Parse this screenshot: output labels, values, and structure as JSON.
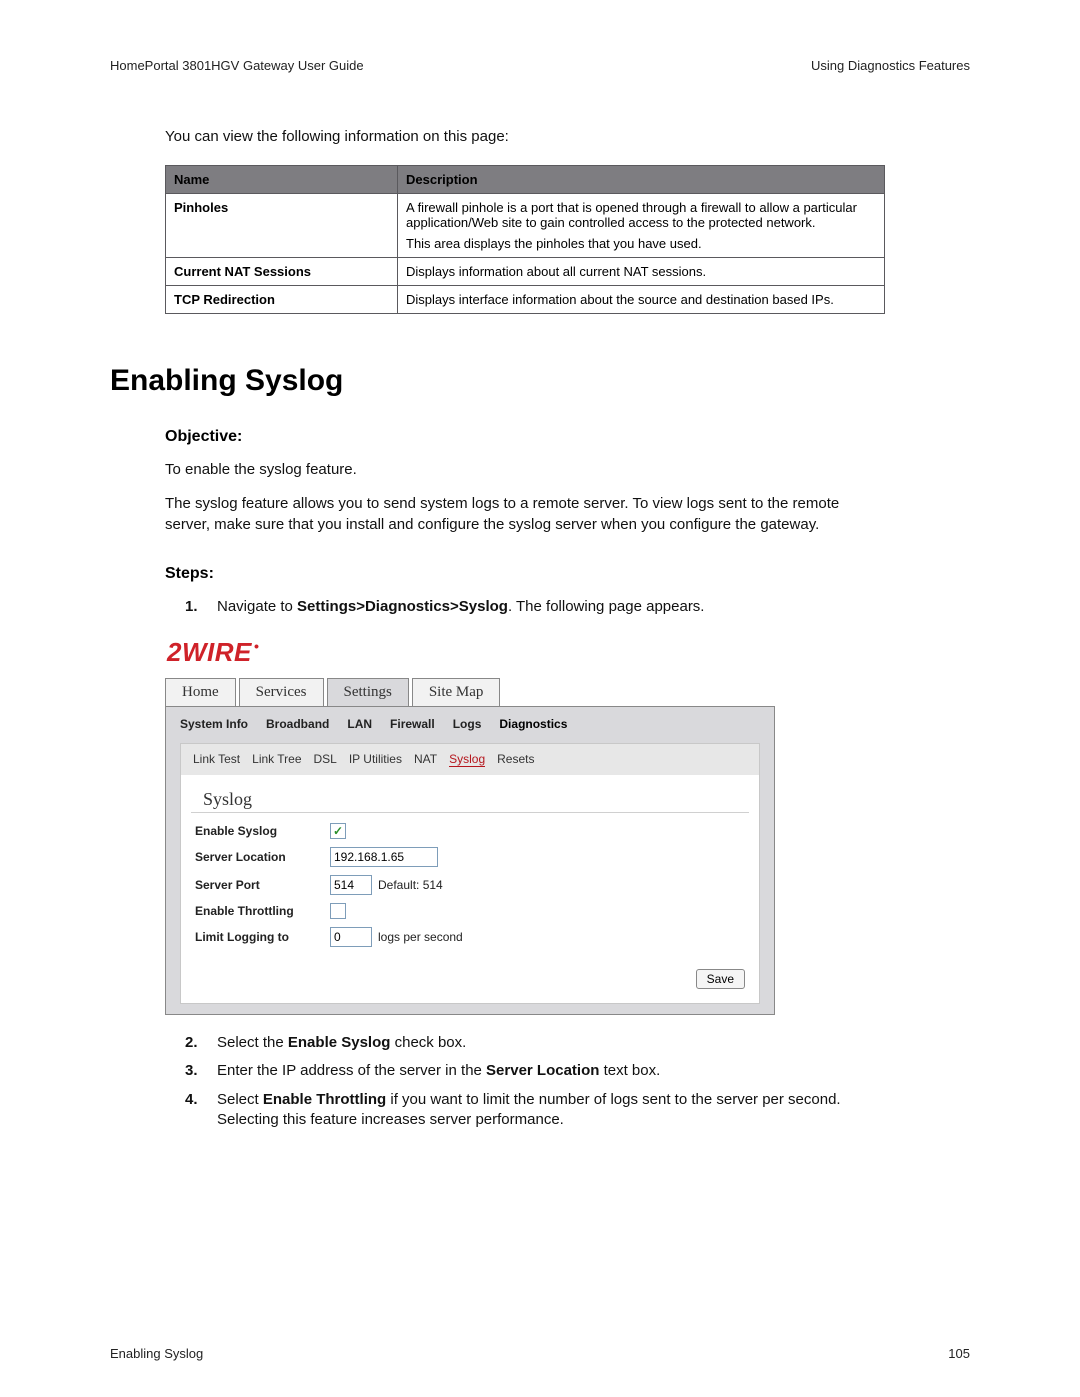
{
  "header": {
    "left": "HomePortal 3801HGV Gateway User Guide",
    "right": "Using Diagnostics Features"
  },
  "intro": "You can view the following information on this page:",
  "table": {
    "headers": [
      "Name",
      "Description"
    ],
    "rows": [
      {
        "name": "Pinholes",
        "desc1": "A firewall pinhole is a port that is opened through a firewall to allow a particular application/Web site to gain controlled access to the protected network.",
        "desc2": "This area displays the pinholes that you have used."
      },
      {
        "name": "Current NAT Sessions",
        "desc1": "Displays information about all current NAT sessions.",
        "desc2": ""
      },
      {
        "name": "TCP Redirection",
        "desc1": "Displays interface information about the source and destination based IPs.",
        "desc2": ""
      }
    ]
  },
  "section_heading": "Enabling Syslog",
  "objective_label": "Objective:",
  "objective_text": "To enable the syslog feature.",
  "objective_paragraph": "The syslog feature allows you to send system logs to a remote server. To view logs sent to the remote server, make sure that you install and configure the syslog server when you configure the gateway.",
  "steps_label": "Steps:",
  "steps": {
    "1": {
      "pre": "Navigate to ",
      "bold": "Settings>Diagnostics>Syslog",
      "post": ". The following page appears."
    },
    "2": {
      "pre": "Select the ",
      "bold": "Enable Syslog",
      "post": " check box."
    },
    "3": {
      "pre": "Enter the IP address of the server in the ",
      "bold": "Server Location",
      "post": " text box."
    },
    "4": {
      "pre": "Select ",
      "bold": "Enable Throttling",
      "post": " if you want to limit the number of logs sent to the server per second. Selecting this feature increases server performance."
    }
  },
  "ui": {
    "logo": "2WIRE",
    "primary_tabs": [
      "Home",
      "Services",
      "Settings",
      "Site Map"
    ],
    "primary_active_index": 2,
    "sub_tabs": [
      "System Info",
      "Broadband",
      "LAN",
      "Firewall",
      "Logs",
      "Diagnostics"
    ],
    "sub_active_index": 5,
    "third_tabs": [
      "Link Test",
      "Link Tree",
      "DSL",
      "IP Utilities",
      "NAT",
      "Syslog",
      "Resets"
    ],
    "third_active_index": 5,
    "panel_title": "Syslog",
    "form": {
      "enable_syslog_label": "Enable Syslog",
      "enable_syslog_checked": "✓",
      "server_location_label": "Server Location",
      "server_location_value": "192.168.1.65",
      "server_port_label": "Server Port",
      "server_port_value": "514",
      "server_port_default": "Default: 514",
      "enable_throttling_label": "Enable Throttling",
      "enable_throttling_checked": "",
      "limit_label": "Limit Logging to",
      "limit_value": "0",
      "limit_suffix": "logs per second",
      "save_label": "Save"
    }
  },
  "footer": {
    "left": "Enabling Syslog",
    "right": "105"
  }
}
